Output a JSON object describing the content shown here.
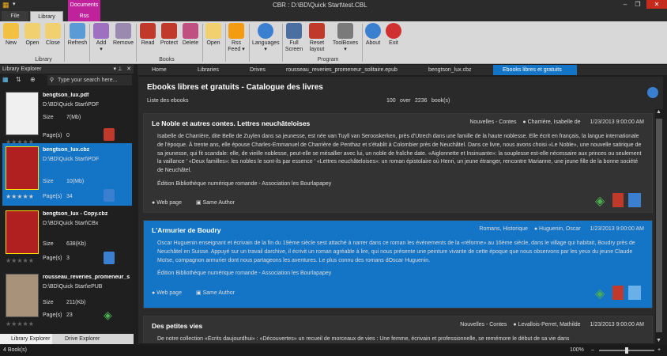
{
  "window": {
    "title": "CBR : D:\\BD\\Quick Start\\test.CBL",
    "context_tab": "Documents"
  },
  "ribbon_tabs": [
    "File",
    "Library",
    "Rss"
  ],
  "ribbon": {
    "buttons": [
      "New",
      "Open",
      "Close",
      "Refresh",
      "Add",
      "Remove",
      "Read",
      "Protect",
      "Delete",
      "Open",
      "Rss Feed",
      "Languages",
      "Full Screen",
      "Reset layout",
      "ToolBoxes",
      "About",
      "Exit"
    ],
    "groups": [
      "Library",
      "Books",
      "Program"
    ]
  },
  "explorer": {
    "title": "Library Explorer",
    "search_placeholder": "Type your search here...",
    "items": [
      {
        "name": "bengtson_lux.pdf",
        "path": "D:\\BD\\Quick Start\\PDF",
        "size_label": "Size",
        "size": "7(Mb)",
        "pages_label": "Page(s)",
        "pages": "0"
      },
      {
        "name": "bengtson_lux.cbz",
        "path": "D:\\BD\\Quick Start\\PDF",
        "size_label": "Size",
        "size": "10(Mb)",
        "pages_label": "Page(s)",
        "pages": "34"
      },
      {
        "name": "bengtson_lux - Copy.cbz",
        "path": "D:\\BD\\Quick Start\\CBx",
        "size_label": "Size",
        "size": "638(Kb)",
        "pages_label": "Page(s)",
        "pages": "3"
      },
      {
        "name": "rousseau_reveries_promeneur_s...",
        "path": "D:\\BD\\Quick Start\\ePUB",
        "size_label": "Size",
        "size": "211(Kb)",
        "pages_label": "Page(s)",
        "pages": "23"
      }
    ],
    "bottom_tabs": [
      "Library Explorer",
      "Drive Explorer"
    ]
  },
  "doc_tabs": [
    "Home",
    "Libraries",
    "Drives",
    "rousseau_reveries_promeneur_solitaire.epub",
    "bengtson_lux.cbz",
    "Ebooks libres et gratuits"
  ],
  "catalog": {
    "title": "Ebooks libres et gratuits - Catalogue des livres",
    "subtitle": "Liste des ebooks",
    "count": "100",
    "over": "over",
    "total": "2236",
    "unit": "book(s)",
    "links": {
      "web": "Web page",
      "author": "Same Author"
    },
    "books": [
      {
        "title": "Le Noble et autres contes. Lettres neuchâteloises",
        "genre": "Nouvelles - Contes",
        "author": "Charrière, Isabelle de",
        "date": "1/23/2013 9:00:00 AM",
        "description": "Isabelle de Charrière, dite Belle de Zuylen dans sa jeunesse, est née van Tuyll van Serooskerken, près d'Utrech dans une famille de la haute noblesse. Elle écrit en français, la langue internationale de l'époque. À trente ans, elle épouse Charles-Emmanuel de Charrière de Penthaz et s'établit à Colombier près de Neuchâtel. Dans ce livre, nous avons choisi «Le Noble», une nouvelle satirique de sa jeunesse, qui fit scandale: elle, de vieille noblesse, peut-elle se mésallier avec lui, un noble de fraîche date. «Aiglonnette et Insinuante»: la souplesse est-elle nécessaire aux princes ou seulement la vaillance ' «Deux familles»: les nobles le sont-ils par essence ' «Lettres neuchâteloises»: un roman épistolaire où Henri, un jeune étranger, rencontre Marianne, une jeune fille  de la bonne société de Neuchâtel.",
        "edition": "Édition Bibliothèque numérique romande - Association les Bourlapapey"
      },
      {
        "title": "L'Armurier de Boudry",
        "genre": "Romans, Historique",
        "author": "Huguenin, Oscar",
        "date": "1/23/2013 9:00:00 AM",
        "description": "Oscar Huguenin enseignant et écrivain de la fin du 19ème siècle sest attaché à narrer dans ce roman les événements de la «réforme» au 16ème siècle, dans le village qui habitait, Boudry près de Neuchâtel en Suisse. Appuyé sur un travail darchive, il écrivit un roman agréable à lire, qui nous présente une peinture vivante de cette époque que nous observons par les yeux du jeune Claude Moïse, compagnon armurier dont nous partageons les aventures. Le plus connu des romans dOscar Huguenin.",
        "edition": "Édition Bibliothèque numérique romande - Association les Bourlapapey"
      },
      {
        "title": "Des petites vies",
        "genre": "Nouvelles - Contes",
        "author": "Levallois-Perret, Mathilde",
        "date": "1/23/2013 9:00:00 AM",
        "description": "De notre collection «Écrits daujourdhui» : «Découvertes» un recueil de morceaux de vies : Une femme, écrivain et professionnelle, se remémore le début de sa vie dans",
        "edition": ""
      }
    ]
  },
  "status": {
    "zoom": "100%",
    "left_count": "4 Book(s)"
  },
  "colors": {
    "accent": "#1474c6",
    "context_tab": "#c0229c",
    "ribbon": "#d8d8d8",
    "dark": "#2a2a2a"
  }
}
